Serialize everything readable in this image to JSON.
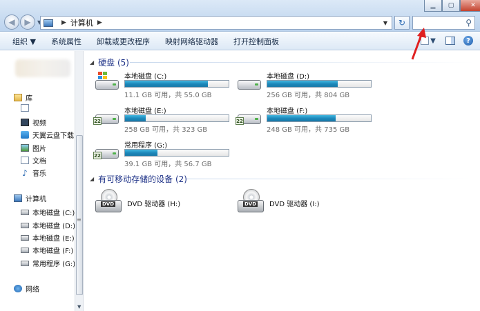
{
  "address": {
    "segments": [
      "计算机"
    ]
  },
  "toolbar": {
    "items": [
      "组织 ▼",
      "系统属性",
      "卸载或更改程序",
      "映射网络驱动器",
      "打开控制面板"
    ]
  },
  "nav": {
    "library": "库",
    "items": [
      "视频",
      "天翼云盘下载",
      "图片",
      "文档",
      "音乐"
    ],
    "computer": "计算机",
    "drives": [
      "本地磁盘 (C:)",
      "本地磁盘 (D:)",
      "本地磁盘 (E:)",
      "本地磁盘 (F:)",
      "常用程序 (G:)"
    ],
    "network": "网络"
  },
  "content": {
    "hdd_section": "硬盘 (5)",
    "removable_section": "有可移动存储的设备 (2)",
    "drives": [
      {
        "name": "本地磁盘 (C:)",
        "free": "11.1 GB 可用，共 55.0 GB",
        "used_fraction": 0.8
      },
      {
        "name": "本地磁盘 (D:)",
        "free": "256 GB 可用，共 804 GB",
        "used_fraction": 0.68
      },
      {
        "name": "本地磁盘 (E:)",
        "free": "258 GB 可用，共 323 GB",
        "used_fraction": 0.2
      },
      {
        "name": "本地磁盘 (F:)",
        "free": "248 GB 可用，共 735 GB",
        "used_fraction": 0.66
      },
      {
        "name": "常用程序 (G:)",
        "free": "39.1 GB 可用，共 56.7 GB",
        "used_fraction": 0.31
      }
    ],
    "dvd_drives": [
      "DVD 驱动器 (H:)",
      "DVD 驱动器 (I:)"
    ],
    "dvd_label": "DVD"
  },
  "colors": {
    "annotation_arrow": "#e02020",
    "bar_fill": "#1b86b9",
    "section_heading": "#1e3287"
  }
}
